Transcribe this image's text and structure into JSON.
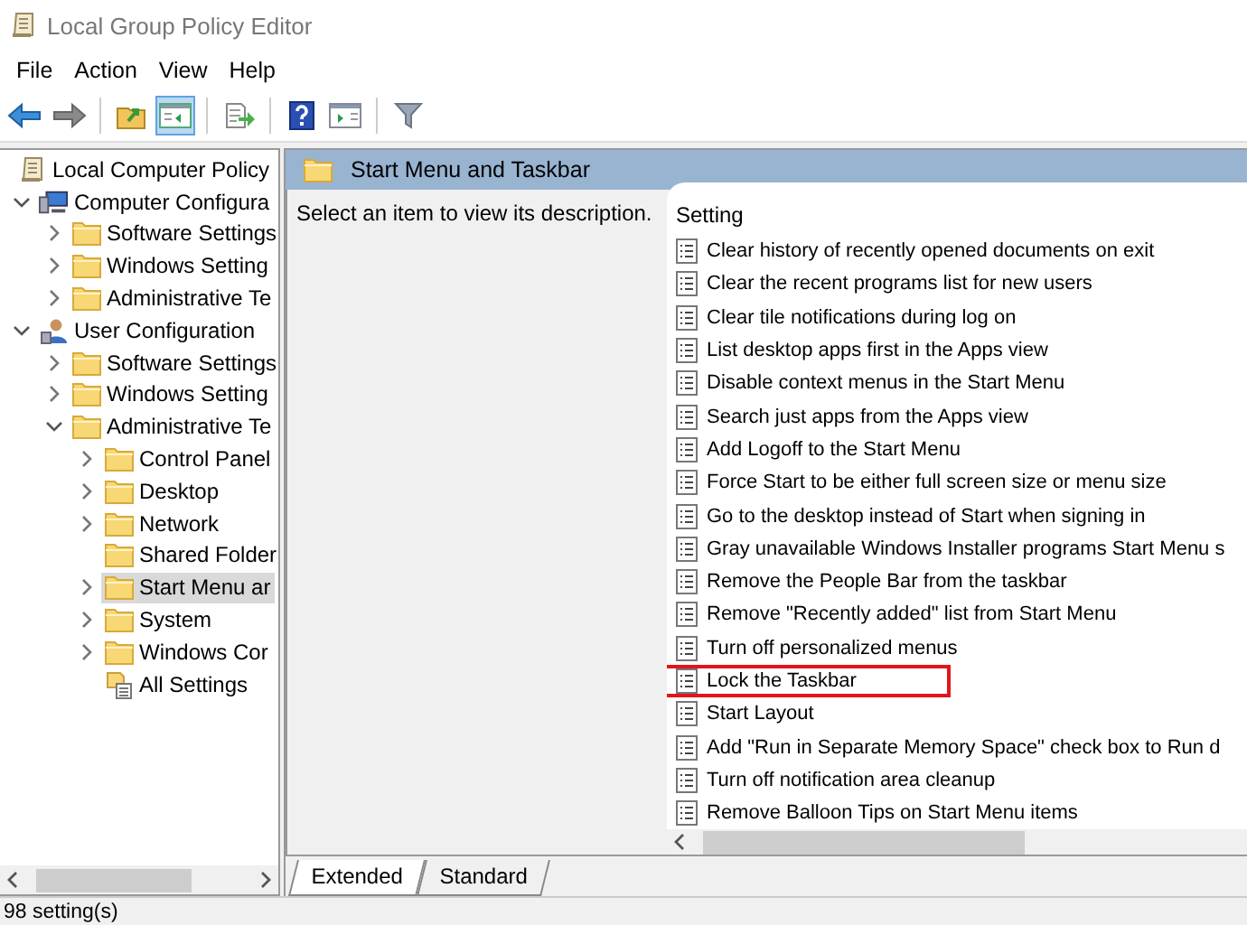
{
  "window": {
    "title": "Local Group Policy Editor"
  },
  "menu": [
    "File",
    "Action",
    "View",
    "Help"
  ],
  "toolbar": [
    [
      {
        "kind": "back",
        "pressed": false
      },
      {
        "kind": "forward",
        "pressed": false
      }
    ],
    [
      {
        "kind": "up",
        "pressed": false
      },
      {
        "kind": "tree",
        "pressed": true
      }
    ],
    [
      {
        "kind": "export",
        "pressed": false
      }
    ],
    [
      {
        "kind": "help",
        "pressed": false
      },
      {
        "kind": "actionpane",
        "pressed": false
      }
    ],
    [
      {
        "kind": "filter",
        "pressed": false
      }
    ]
  ],
  "tree": [
    {
      "label": "Local Computer Policy",
      "kind": "policy",
      "selected": false,
      "children": [
        {
          "label": "Computer Configura",
          "kind": "computer",
          "expanded": true,
          "selected": false,
          "children": [
            {
              "label": "Software Settings",
              "kind": "folder",
              "expanded": false,
              "selected": false
            },
            {
              "label": "Windows Setting",
              "kind": "folder",
              "expanded": false,
              "selected": false
            },
            {
              "label": "Administrative Te",
              "kind": "folder",
              "expanded": false,
              "selected": false
            }
          ]
        },
        {
          "label": "User Configuration",
          "kind": "user",
          "expanded": true,
          "selected": false,
          "children": [
            {
              "label": "Software Settings",
              "kind": "folder",
              "expanded": false,
              "selected": false
            },
            {
              "label": "Windows Setting",
              "kind": "folder",
              "expanded": false,
              "selected": false
            },
            {
              "label": "Administrative Te",
              "kind": "folder",
              "expanded": true,
              "selected": false,
              "children": [
                {
                  "label": "Control Panel",
                  "kind": "folder",
                  "expanded": false,
                  "selected": false
                },
                {
                  "label": "Desktop",
                  "kind": "folder",
                  "expanded": false,
                  "selected": false
                },
                {
                  "label": "Network",
                  "kind": "folder",
                  "expanded": false,
                  "selected": false
                },
                {
                  "label": "Shared Folder",
                  "kind": "folder",
                  "selected": false
                },
                {
                  "label": "Start Menu ar",
                  "kind": "folder",
                  "expanded": false,
                  "selected": true
                },
                {
                  "label": "System",
                  "kind": "folder",
                  "expanded": false,
                  "selected": false
                },
                {
                  "label": "Windows Cor",
                  "kind": "folder",
                  "expanded": false,
                  "selected": false
                },
                {
                  "label": "All Settings",
                  "kind": "allsettings",
                  "selected": false
                }
              ]
            }
          ]
        }
      ]
    }
  ],
  "details": {
    "header": "Start Menu and Taskbar",
    "description": "Select an item to view its description.",
    "column": "Setting",
    "settings": [
      {
        "name": "Clear history of recently opened documents on exit",
        "highlighted": false
      },
      {
        "name": "Clear the recent programs list for new users",
        "highlighted": false
      },
      {
        "name": "Clear tile notifications during log on",
        "highlighted": false
      },
      {
        "name": "List desktop apps first in the Apps view",
        "highlighted": false
      },
      {
        "name": "Disable context menus in the Start Menu",
        "highlighted": false
      },
      {
        "name": "Search just apps from the Apps view",
        "highlighted": false
      },
      {
        "name": "Add Logoff to the Start Menu",
        "highlighted": false
      },
      {
        "name": "Force Start to be either full screen size or menu size",
        "highlighted": false
      },
      {
        "name": "Go to the desktop instead of Start when signing in",
        "highlighted": false
      },
      {
        "name": "Gray unavailable Windows Installer programs Start Menu s",
        "highlighted": false
      },
      {
        "name": "Remove the People Bar from the taskbar",
        "highlighted": false
      },
      {
        "name": "Remove \"Recently added\" list from Start Menu",
        "highlighted": false
      },
      {
        "name": "Turn off personalized menus",
        "highlighted": false
      },
      {
        "name": "Lock the Taskbar",
        "highlighted": true
      },
      {
        "name": "Start Layout",
        "highlighted": false
      },
      {
        "name": "Add \"Run in Separate Memory Space\" check box to Run d",
        "highlighted": false
      },
      {
        "name": "Turn off notification area cleanup",
        "highlighted": false
      },
      {
        "name": "Remove Balloon Tips on Start Menu items",
        "highlighted": false
      }
    ],
    "tabs": [
      {
        "label": "Extended",
        "selected": true
      },
      {
        "label": "Standard",
        "selected": false
      }
    ]
  },
  "status_bar": "98 setting(s)"
}
